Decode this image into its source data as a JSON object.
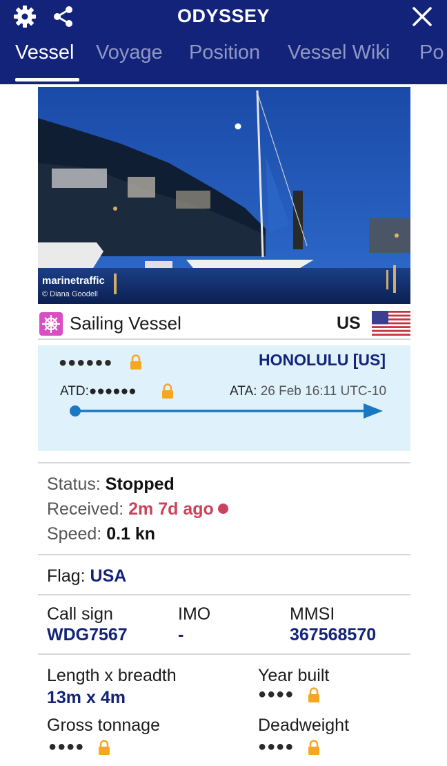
{
  "header": {
    "title": "ODYSSEY",
    "icons": [
      "gear-icon",
      "share-icon",
      "close-icon"
    ],
    "tabs": [
      {
        "label": "Vessel",
        "active": true
      },
      {
        "label": "Voyage",
        "active": false
      },
      {
        "label": "Position",
        "active": false
      },
      {
        "label": "Vessel Wiki",
        "active": false
      },
      {
        "label": "Po",
        "active": false
      }
    ]
  },
  "photo": {
    "watermark": "marinetraffic",
    "credit": "© Diana Goodell"
  },
  "vessel": {
    "type": "Sailing Vessel",
    "country_code": "US"
  },
  "voyage": {
    "origin_masked": "●●●●●●",
    "destination": "HONOLULU [US]",
    "atd_label": "ATD:",
    "atd_masked": "●●●●●●",
    "ata_label": "ATA:",
    "ata_value": "26 Feb 16:11 UTC-10"
  },
  "status": {
    "status_label": "Status:",
    "status_value": "Stopped",
    "received_label": "Received:",
    "received_value": "2m 7d ago",
    "speed_label": "Speed:",
    "speed_value": "0.1 kn"
  },
  "flag": {
    "label": "Flag:",
    "value": "USA"
  },
  "identifiers": {
    "call_sign_label": "Call sign",
    "call_sign_value": "WDG7567",
    "imo_label": "IMO",
    "imo_value": "-",
    "mmsi_label": "MMSI",
    "mmsi_value": "367568570"
  },
  "specs": {
    "length_label": "Length x breadth",
    "length_value": "13m x 4m",
    "year_label": "Year built",
    "year_masked": "●●●●",
    "gross_label": "Gross tonnage",
    "gross_masked": "●●●●",
    "deadweight_label": "Deadweight",
    "deadweight_masked": "●●●●"
  },
  "colors": {
    "header_bg": "#13237a",
    "accent_blue": "#1a78c2",
    "lock_orange": "#f5a623",
    "alert_red": "#c9435b",
    "voyage_bg": "#dff1fb",
    "type_icon_bg": "#d94ec2"
  }
}
